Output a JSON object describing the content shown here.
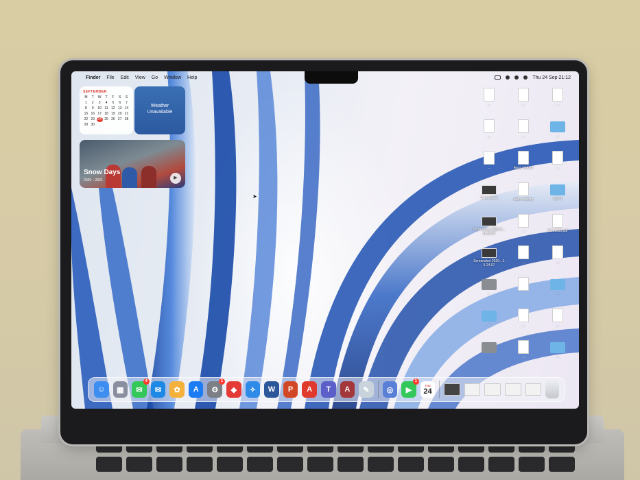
{
  "menubar": {
    "apple_icon": "",
    "app_name": "Finder",
    "menus": [
      "File",
      "Edit",
      "View",
      "Go",
      "Window",
      "Help"
    ],
    "clock": "Thu 24 Sep  21:12"
  },
  "widgets": {
    "calendar": {
      "month": "SEPTEMBER",
      "days": [
        "M",
        "T",
        "W",
        "T",
        "F",
        "S",
        "S"
      ],
      "dates": [
        "1",
        "2",
        "3",
        "4",
        "5",
        "6",
        "7",
        "8",
        "9",
        "10",
        "11",
        "12",
        "13",
        "14",
        "15",
        "16",
        "17",
        "18",
        "19",
        "20",
        "21",
        "22",
        "23",
        "24",
        "25",
        "26",
        "27",
        "28",
        "29",
        "30"
      ],
      "today": "24"
    },
    "weather": {
      "line1": "Weather",
      "line2": "Unavailable"
    },
    "photo": {
      "title": "Snow Days",
      "subtitle": "2020 – 2021"
    }
  },
  "desktop_icons": [
    {
      "type": "doc",
      "label": "…"
    },
    {
      "type": "doc",
      "label": "…"
    },
    {
      "type": "doc",
      "label": "…"
    },
    {
      "type": "doc",
      "label": "…"
    },
    {
      "type": "doc",
      "label": "…"
    },
    {
      "type": "folder",
      "label": "…"
    },
    {
      "type": "doc",
      "label": "…"
    },
    {
      "type": "doc",
      "label": "Asos mekcm"
    },
    {
      "type": "doc",
      "label": "…"
    },
    {
      "type": "shot",
      "label": "Screenshot"
    },
    {
      "type": "doc",
      "label": "Asos mekcm"
    },
    {
      "type": "folder",
      "label": "sprdo"
    },
    {
      "type": "shot",
      "label": "Screenshot 2026-0…11.58.37"
    },
    {
      "type": "doc",
      "label": "…"
    },
    {
      "type": "doc",
      "label": "02.11633.pdf"
    },
    {
      "type": "shot",
      "label": "Screenshot 2026…15.24.07"
    },
    {
      "type": "doc",
      "label": "…"
    },
    {
      "type": "doc",
      "label": "…"
    },
    {
      "type": "folder-dark",
      "label": "…"
    },
    {
      "type": "doc",
      "label": "…"
    },
    {
      "type": "folder",
      "label": "…"
    },
    {
      "type": "folder",
      "label": "…"
    },
    {
      "type": "doc",
      "label": "…"
    },
    {
      "type": "doc",
      "label": "…"
    },
    {
      "type": "folder-dark",
      "label": "…"
    },
    {
      "type": "doc",
      "label": "…"
    },
    {
      "type": "folder",
      "label": "…"
    }
  ],
  "dock": {
    "apps": [
      {
        "name": "finder",
        "icon": "☺",
        "color": "#3d8ef0",
        "badge": ""
      },
      {
        "name": "launchpad",
        "icon": "▦",
        "color": "#8a8fa0",
        "badge": ""
      },
      {
        "name": "messages",
        "icon": "✉",
        "color": "#34c759",
        "badge": "4"
      },
      {
        "name": "mail",
        "icon": "✉",
        "color": "#1e88e5",
        "badge": ""
      },
      {
        "name": "photos",
        "icon": "✿",
        "color": "#f4b23c",
        "badge": ""
      },
      {
        "name": "app-store",
        "icon": "A",
        "color": "#1c7cf4",
        "badge": ""
      },
      {
        "name": "system-settings",
        "icon": "⚙",
        "color": "#7d7f86",
        "badge": "1"
      },
      {
        "name": "app-red",
        "icon": "◆",
        "color": "#e53935",
        "badge": ""
      },
      {
        "name": "safari",
        "icon": "✧",
        "color": "#2e8be8",
        "badge": ""
      },
      {
        "name": "word",
        "icon": "W",
        "color": "#2b579a",
        "badge": ""
      },
      {
        "name": "powerpoint",
        "icon": "P",
        "color": "#d24726",
        "badge": ""
      },
      {
        "name": "acrobat",
        "icon": "A",
        "color": "#e03a2f",
        "badge": ""
      },
      {
        "name": "teams",
        "icon": "T",
        "color": "#5b5fc7",
        "badge": ""
      },
      {
        "name": "access",
        "icon": "A",
        "color": "#a4373a",
        "badge": ""
      },
      {
        "name": "preview",
        "icon": "✎",
        "color": "#c8d3dc",
        "badge": ""
      }
    ],
    "apps2": [
      {
        "name": "chatgpt",
        "icon": "◎",
        "color": "#5a7fd6",
        "badge": ""
      },
      {
        "name": "facetime",
        "icon": "▶",
        "color": "#34c759",
        "badge": "1"
      }
    ],
    "calendar_app": {
      "dow": "THU",
      "day": "24"
    }
  }
}
